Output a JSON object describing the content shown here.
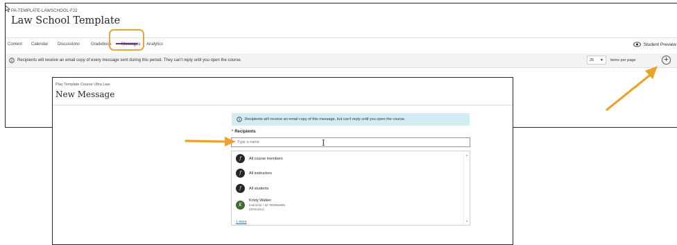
{
  "course": {
    "code": "PA-TEMPLATE-LAWSCHOOL-F22",
    "title": "Law School Template",
    "tabs": [
      {
        "label": "Content"
      },
      {
        "label": "Calendar"
      },
      {
        "label": "Discussions"
      },
      {
        "label": "Gradebook"
      },
      {
        "label": "Messages"
      },
      {
        "label": "Analytics"
      }
    ],
    "student_preview_label": "Student Preview",
    "info_text": "Recipients will receive an email copy of every message sent during this period. They can't reply until you open the course.",
    "page_size": "25",
    "items_per_page_label": "items per page"
  },
  "new_message": {
    "course_name": "Play Template Course Ultra Law",
    "title": "New Message",
    "info_text": "Recipients will receive an email copy of this message, but can't reply until you open the course.",
    "recipients_label": "Recipients",
    "recipients_placeholder": "Type a name",
    "options": [
      {
        "label": "All course members"
      },
      {
        "label": "All instructors"
      },
      {
        "label": "All students"
      }
    ],
    "user": {
      "name": "Kristy Walker",
      "detail": "Instructor / ID: 900962896",
      "role": "(Instructor)"
    },
    "more_link": "1 more"
  },
  "colors": {
    "accent": "#6f2a8f",
    "highlight": "#e7a43a",
    "arrow": "#eaa22b",
    "info_bg": "#d3ecf3"
  }
}
